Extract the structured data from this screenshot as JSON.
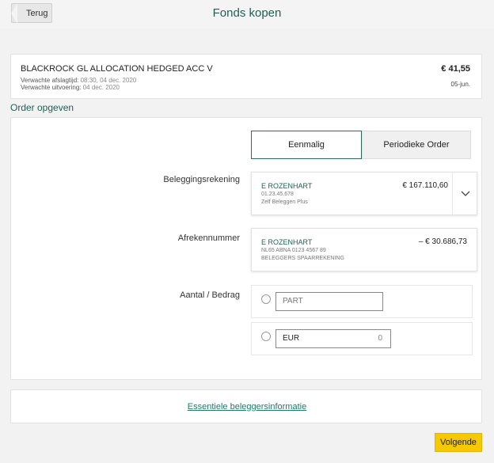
{
  "header": {
    "back_label": "Terug",
    "title": "Fonds kopen"
  },
  "fund": {
    "name": "BLACKROCK GL ALLOCATION HEDGED ACC V",
    "cutoff_label": "Verwachte afslagtijd:",
    "cutoff_value": "08:30, 04 dec. 2020",
    "execution_label": "Verwachte uitvoering:",
    "execution_value": "04 dec. 2020",
    "price": "€ 41,55",
    "price_date": "05-jun."
  },
  "order": {
    "section_title": "Order opgeven",
    "tabs": [
      {
        "label": "Eenmalig",
        "selected": true
      },
      {
        "label": "Periodieke Order",
        "selected": false
      }
    ],
    "investment_account": {
      "label": "Beleggingsrekening",
      "name": "E ROZENHART",
      "number": "01.23.45.678",
      "type": "Zelf Beleggen Plus",
      "amount": "€ 167.110,60"
    },
    "settlement_account": {
      "label": "Afrekennummer",
      "name": "E ROZENHART",
      "number": "NL65 ABNA 0123 4567 89",
      "type": "BELEGGERS SPAARREKENING",
      "amount": "–  € 30.686,73"
    },
    "quantity": {
      "label": "Aantal / Bedrag",
      "units_placeholder": "PART",
      "currency": "EUR",
      "amount_value": "0"
    }
  },
  "info_link": "Essentiele beleggersinformatie",
  "next_label": "Volgende",
  "colors": {
    "accent": "#1f5f54",
    "button": "#f5c800",
    "link": "#1f7a6a"
  }
}
